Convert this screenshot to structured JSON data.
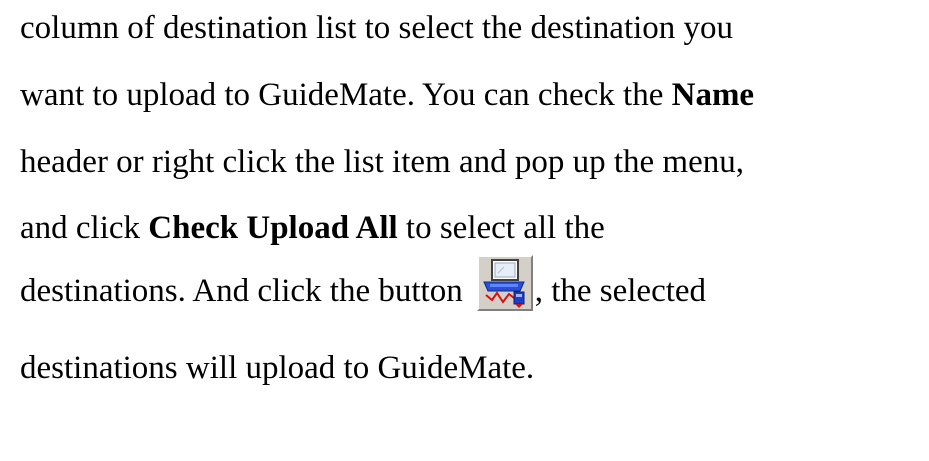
{
  "paragraph": {
    "line1": "column of destination list to select the destination you",
    "line2_a": "want to upload to GuideMate. You can check the ",
    "line2_b": "Name",
    "line3": "header or right click the list item and pop up the menu,",
    "line4_a": "and click ",
    "line4_b": "Check Upload All",
    "line4_c": " to select all the",
    "line5_a": "destinations. And click the button",
    "line5_b": ", the selected",
    "line6": "destinations will upload to GuideMate."
  },
  "upload_button": {
    "icon": "upload-to-device-icon"
  }
}
